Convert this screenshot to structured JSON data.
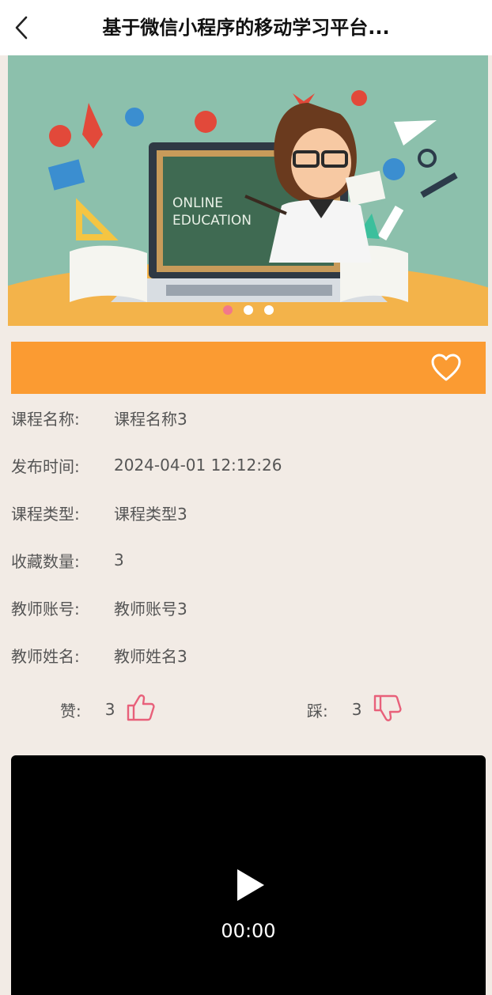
{
  "nav": {
    "title": "基于微信小程序的移动学习平台..."
  },
  "banner": {
    "board_text_line1": "ONLINE",
    "board_text_line2": "EDUCATION",
    "slides": 3,
    "active_slide": 1
  },
  "details": [
    {
      "label": "课程名称:",
      "value": "课程名称3"
    },
    {
      "label": "发布时间:",
      "value": "2024-04-01 12:12:26"
    },
    {
      "label": "课程类型:",
      "value": "课程类型3"
    },
    {
      "label": "收藏数量:",
      "value": "3"
    },
    {
      "label": "教师账号:",
      "value": "教师账号3"
    },
    {
      "label": "教师姓名:",
      "value": "教师姓名3"
    }
  ],
  "votes": {
    "like_label": "赞:",
    "like_count": "3",
    "dislike_label": "踩:",
    "dislike_count": "3"
  },
  "video": {
    "time": "00:00"
  },
  "colors": {
    "orange_bar": "#fb9b32",
    "background": "#f2ebe5",
    "thumb_icon": "#e8607a",
    "banner_teal": "#8cc0ac"
  }
}
